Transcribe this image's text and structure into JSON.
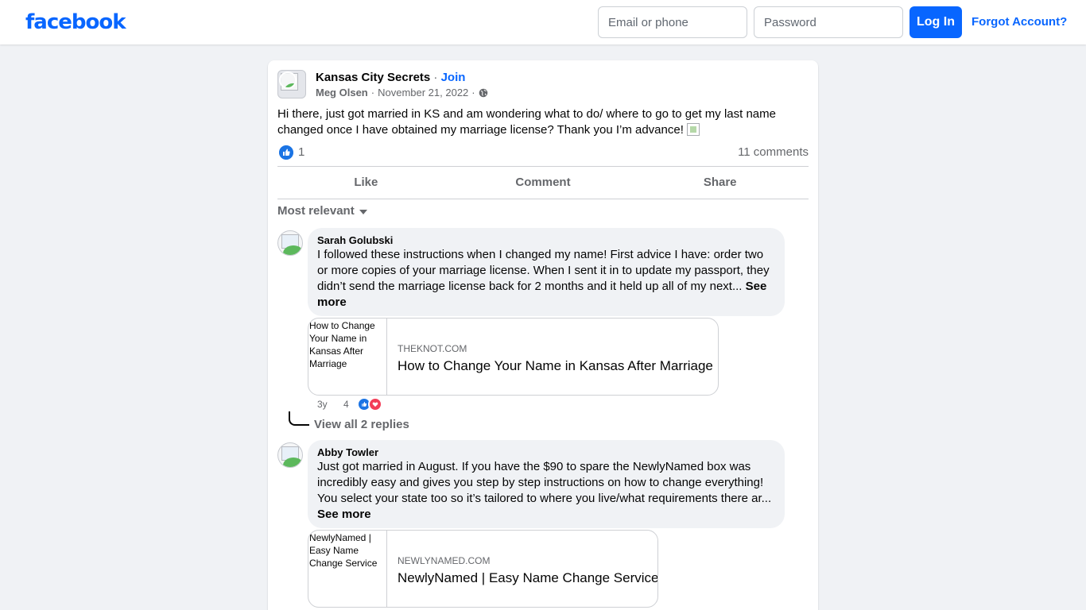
{
  "header": {
    "logo": "facebook",
    "email_placeholder": "Email or phone",
    "password_placeholder": "Password",
    "login_label": "Log In",
    "forgot_label": "Forgot Account?"
  },
  "post": {
    "group_name": "Kansas City Secrets",
    "separator": " · ",
    "join_label": "Join",
    "author": "Meg Olsen",
    "date": "November 21, 2022",
    "dot": "·",
    "text": "Hi there, just got married in KS and am wondering what  to do/ where to go to get my last name changed once I have obtained my marriage license? Thank you I’m advance!",
    "like_count": "1",
    "comments_count": "11 comments"
  },
  "actions": {
    "like": "Like",
    "comment": "Comment",
    "share": "Share"
  },
  "sort_label": "Most relevant",
  "comments": [
    {
      "author": "Sarah Golubski",
      "text": "I followed these instructions when I changed my name! First advice I have: order two or more copies of your marriage license. When I sent it in to update my passport, they didn’t send the marriage license back for 2 months and it held up all of my next...",
      "see_more": "See more",
      "link_thumb_alt": "How to Change Your Name in Kansas After Marriage",
      "link_domain": "THEKNOT.COM",
      "link_title": "How to Change Your Name in Kansas After Marriage",
      "age": "3y",
      "reaction_count": "4",
      "view_replies": "View all 2 replies"
    },
    {
      "author": "Abby Towler",
      "text": "Just got married in August. If you have the $90 to spare the NewlyNamed box was incredibly easy and gives you step by step instructions on how to change everything! You select your state too so it’s tailored to where you live/what requirements there ar...",
      "see_more": "See more",
      "link_thumb_alt": "NewlyNamed | Easy Name Change Service",
      "link_domain": "NEWLYNAMED.COM",
      "link_title": "NewlyNamed | Easy Name Change Service"
    }
  ],
  "colors": {
    "brand": "#0866ff",
    "like": "#1b74e4",
    "love": "#f33e58",
    "page_bg": "#f0f2f5"
  }
}
